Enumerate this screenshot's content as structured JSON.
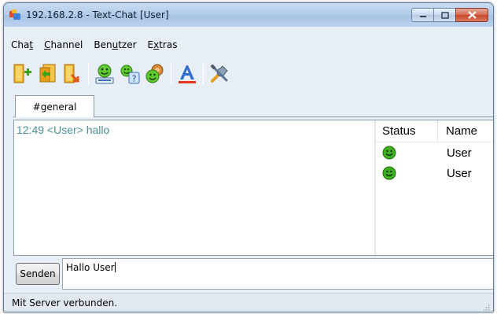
{
  "window": {
    "title": "192.168.2.8 - Text-Chat [User]"
  },
  "menu": [
    {
      "pre": "Cha",
      "key": "t",
      "post": ""
    },
    {
      "pre": "",
      "key": "C",
      "post": "hannel"
    },
    {
      "pre": "Ben",
      "key": "u",
      "post": "tzer"
    },
    {
      "pre": "E",
      "key": "x",
      "post": "tras"
    }
  ],
  "toolbar": {
    "icons": [
      "join-channel-icon",
      "channel-list-icon",
      "leave-channel-icon",
      "whois-icon",
      "user-query-icon",
      "user-settings-icon",
      "font-color-icon",
      "settings-icon"
    ]
  },
  "tabs": [
    {
      "label": "#general"
    }
  ],
  "chat": {
    "lines": [
      "12:49 <User> hallo"
    ]
  },
  "user_list": {
    "headers": {
      "status": "Status",
      "name": "Name"
    },
    "users": [
      {
        "status": "online",
        "name": "User"
      },
      {
        "status": "online",
        "name": "User"
      }
    ]
  },
  "input": {
    "send_label": "Senden",
    "value": "Hallo User"
  },
  "statusbar": {
    "text": "Mit Server verbunden."
  },
  "colors": {
    "chat_text": "#4a8f94",
    "status_online": "#3fae1f"
  }
}
